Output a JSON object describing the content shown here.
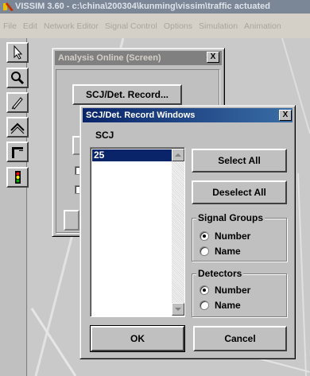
{
  "app": {
    "title": "VISSIM 3.60 - c:\\china\\200304\\kunming\\vissim\\traffic actuated",
    "menu": [
      "File",
      "Edit",
      "Network Editor",
      "Signal Control",
      "Options",
      "Simulation",
      "Animation"
    ]
  },
  "toolbar": {
    "tools": [
      "select-arrow-icon",
      "zoom-magnifier-icon",
      "edit-pen-icon",
      "links-icon",
      "signal-head-icon",
      "traffic-light-icon"
    ]
  },
  "analysis_window": {
    "title": "Analysis Online (Screen)",
    "close": "X",
    "record_button": "SCJ/Det. Record..."
  },
  "record_dialog": {
    "title": "SCJ/Det. Record Windows",
    "close": "X",
    "list_label": "SCJ",
    "list_items": [
      "25"
    ],
    "select_all": "Select All",
    "deselect_all": "Deselect All",
    "signal_groups": {
      "label": "Signal Groups",
      "options": [
        "Number",
        "Name"
      ],
      "selected": "Number"
    },
    "detectors": {
      "label": "Detectors",
      "options": [
        "Number",
        "Name"
      ],
      "selected": "Number"
    },
    "ok": "OK",
    "cancel": "Cancel"
  },
  "colors": {
    "active_caption": "#0a246a",
    "inactive_caption": "#808080",
    "face": "#c0c0c0",
    "selection": "#0a246a"
  }
}
